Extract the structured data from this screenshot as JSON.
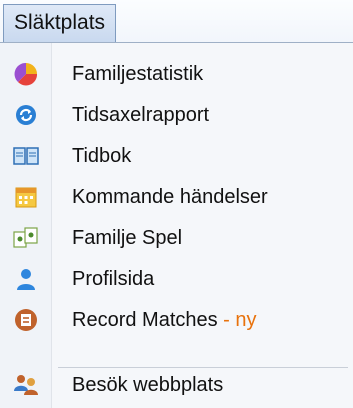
{
  "menu": {
    "title": "Släktplats"
  },
  "items": [
    {
      "label": "Familjestatistik",
      "icon": "pie-chart-icon"
    },
    {
      "label": "Tidsaxelrapport",
      "icon": "timeline-cycle-icon"
    },
    {
      "label": "Tidbok",
      "icon": "open-book-icon"
    },
    {
      "label": "Kommande händelser",
      "icon": "calendar-icon"
    },
    {
      "label": "Familje Spel",
      "icon": "game-cards-icon"
    },
    {
      "label": "Profilsida",
      "icon": "person-icon"
    },
    {
      "label": "Record Matches",
      "suffix": " - ny",
      "icon": "record-matches-icon"
    },
    {
      "label": "Besök webbplats",
      "icon": "people-icon"
    }
  ],
  "colors": {
    "accent_new": "#e8720c"
  }
}
